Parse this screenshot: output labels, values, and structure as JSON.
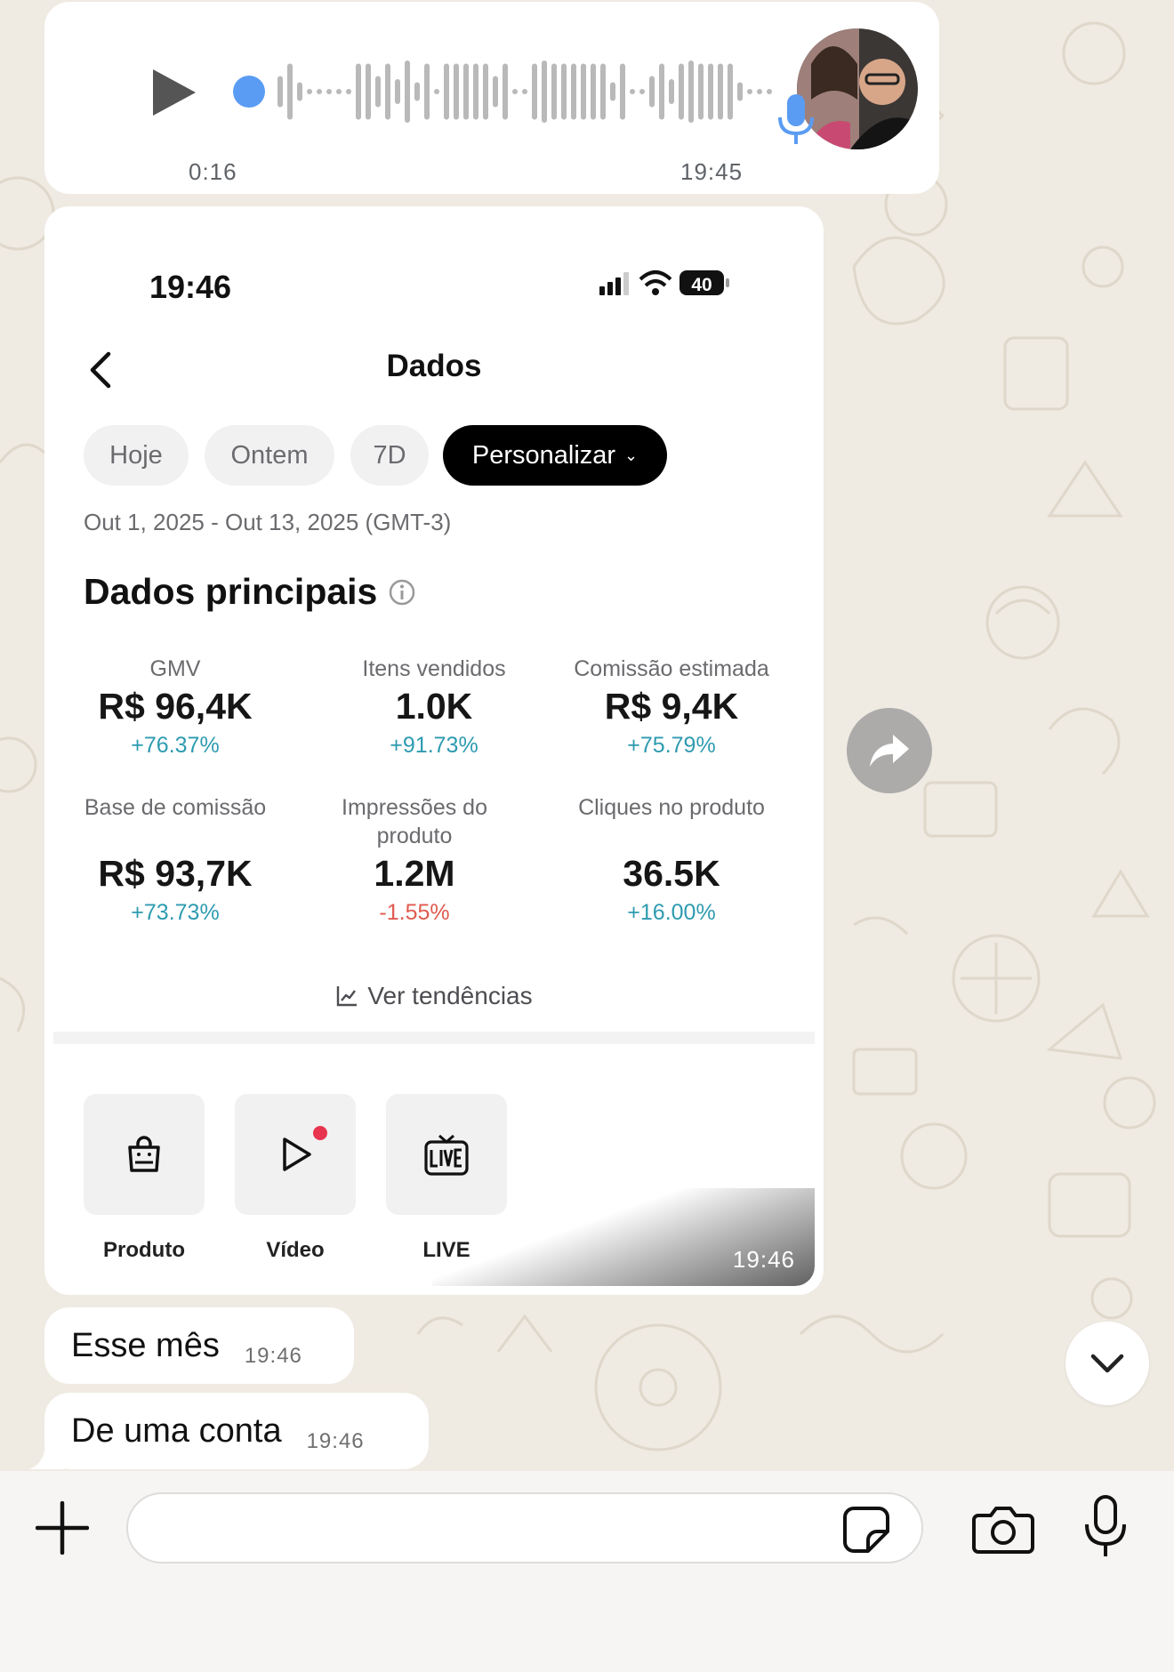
{
  "voice_message": {
    "duration": "0:16",
    "time": "19:45",
    "icons": {
      "play": "play-icon",
      "mic": "mic-icon"
    },
    "accent_color": "#5a9cf3"
  },
  "image_message": {
    "time": "19:46",
    "screenshot": {
      "status_time": "19:46",
      "battery": "40",
      "title": "Dados",
      "filters": [
        "Hoje",
        "Ontem",
        "7D",
        "Personalizar"
      ],
      "active_filter": "Personalizar",
      "date_range": "Out 1, 2025 - Out 13, 2025 (GMT-3)",
      "section_title": "Dados principais",
      "metrics": [
        {
          "label": "GMV",
          "value": "R$ 96,4K",
          "change": "+76.37%",
          "trend": "up"
        },
        {
          "label": "Itens vendidos",
          "value": "1.0K",
          "change": "+91.73%",
          "trend": "up"
        },
        {
          "label": "Comissão estimada",
          "value": "R$ 9,4K",
          "change": "+75.79%",
          "trend": "up"
        },
        {
          "label": "Base de comissão",
          "value": "R$ 93,7K",
          "change": "+73.73%",
          "trend": "up"
        },
        {
          "label": "Impressões do produto",
          "value": "1.2M",
          "change": "-1.55%",
          "trend": "down"
        },
        {
          "label": "Cliques no produto",
          "value": "36.5K",
          "change": "+16.00%",
          "trend": "up"
        }
      ],
      "trends_link": "Ver tendências",
      "tiles": [
        {
          "label": "Produto",
          "icon": "shopping-bag-icon"
        },
        {
          "label": "Vídeo",
          "icon": "video-play-icon"
        },
        {
          "label": "LIVE",
          "icon": "live-tv-icon"
        }
      ],
      "colors": {
        "positive": "#2e9bb0",
        "negative": "#e05a4f",
        "notification_dot": "#e8344e"
      }
    }
  },
  "text_messages": [
    {
      "text": "Esse mês",
      "time": "19:46"
    },
    {
      "text": "De uma conta",
      "time": "19:46"
    }
  ],
  "composer": {
    "icons": [
      "plus-icon",
      "sticker-icon",
      "camera-icon",
      "microphone-icon"
    ]
  },
  "icons": {
    "forward": "forward-icon",
    "scroll_down": "chevron-down-icon"
  }
}
